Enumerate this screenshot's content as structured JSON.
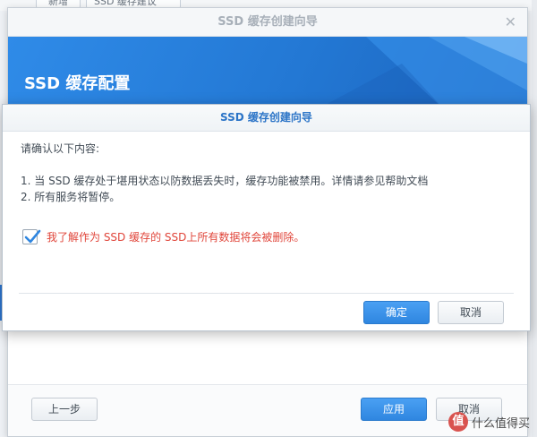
{
  "background": {
    "tabs": [
      "新增",
      "SSD 缓存建议"
    ]
  },
  "wizard": {
    "title": "SSD 缓存创建向导",
    "close_glyph": "✕",
    "banner_title": "SSD 缓存配置",
    "buttons": {
      "prev": "上一步",
      "apply": "应用",
      "cancel": "取消"
    }
  },
  "dialog": {
    "title": "SSD 缓存创建向导",
    "intro": "请确认以下内容:",
    "items": [
      "1. 当 SSD 缓存处于堪用状态以防数据丢失时，缓存功能被禁用。详情请参见帮助文档",
      "2. 所有服务将暂停。"
    ],
    "acknowledge": {
      "checked": true,
      "label": "我了解作为 SSD 缓存的 SSD上所有数据将会被删除。"
    },
    "buttons": {
      "ok": "确定",
      "cancel": "取消"
    }
  },
  "watermark": {
    "badge": "值",
    "text": "什么值得买"
  },
  "colors": {
    "accent": "#2f86e0",
    "warning": "#e0453a",
    "dialog_title": "#2b74c7"
  }
}
